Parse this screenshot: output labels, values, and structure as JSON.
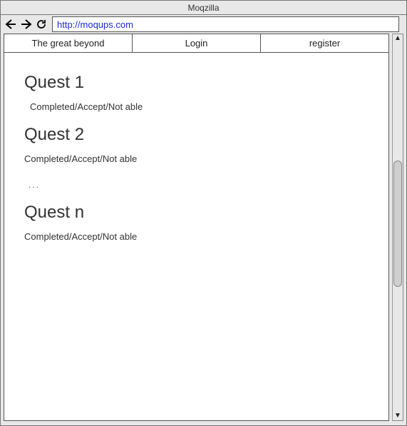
{
  "window": {
    "title": "Moqzilla"
  },
  "toolbar": {
    "url": "http://moqups.com"
  },
  "tabs": [
    {
      "label": "The great beyond"
    },
    {
      "label": "Login"
    },
    {
      "label": "register"
    }
  ],
  "quests": [
    {
      "title": "Quest 1",
      "status": "Completed/Accept/Not able"
    },
    {
      "title": "Quest 2",
      "status": "Completed/Accept/Not able"
    }
  ],
  "ellipsis": "...",
  "quest_n": {
    "title": "Quest n",
    "status": "Completed/Accept/Not able"
  }
}
